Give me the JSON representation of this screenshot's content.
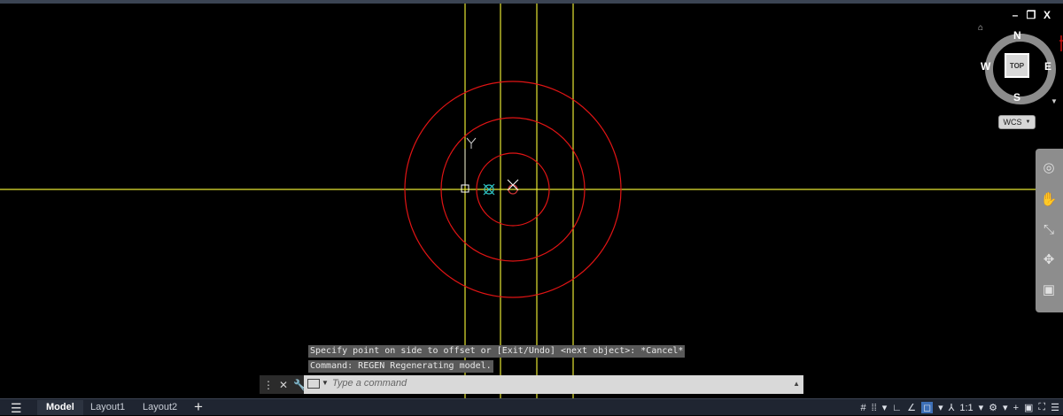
{
  "window": {
    "minimize": "–",
    "restore": "❐",
    "close": "X"
  },
  "viewcube": {
    "north": "N",
    "south": "S",
    "east": "E",
    "west": "W",
    "face": "TOP",
    "home_icon": "house-icon"
  },
  "ucs": {
    "label": "WCS"
  },
  "navbar": {
    "icons": [
      "steering-wheel-icon",
      "pan-icon",
      "zoom-icon",
      "orbit-icon",
      "showmotion-icon"
    ]
  },
  "command_history": [
    "Specify point on side to offset or [Exit/Undo] <next object>: *Cancel*",
    "Command: REGEN Regenerating model."
  ],
  "command_line": {
    "placeholder": "Type a command"
  },
  "layout_tabs": [
    {
      "label": "Model",
      "active": true
    },
    {
      "label": "Layout1",
      "active": false
    },
    {
      "label": "Layout2",
      "active": false
    }
  ],
  "status": {
    "annotation_scale": "1:1"
  },
  "colors": {
    "crosshair": "#ffff66",
    "circles": "#ff0000",
    "background": "#000000"
  }
}
